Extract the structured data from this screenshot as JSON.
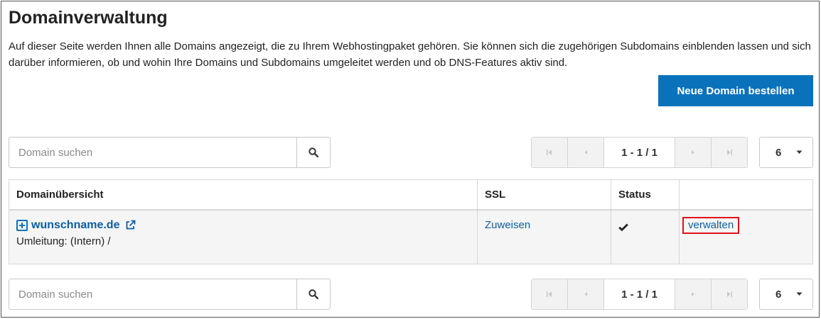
{
  "page": {
    "title": "Domainverwaltung",
    "description": "Auf dieser Seite werden Ihnen alle Domains angezeigt, die zu Ihrem Webhostingpaket gehören. Sie können sich die zugehörigen Subdomains einblenden lassen und sich darüber informieren, ob und wohin Ihre Domains und Subdomains umgeleitet werden und ob DNS-Features aktiv sind.",
    "order_button": "Neue Domain bestellen"
  },
  "search": {
    "placeholder": "Domain suchen",
    "value": "",
    "icon": "search-icon"
  },
  "pagination": {
    "info": "1 - 1 / 1",
    "per_page": "6"
  },
  "table": {
    "columns": [
      "Domainübersicht",
      "SSL",
      "Status",
      ""
    ],
    "rows": [
      {
        "domain": "wunschname.de",
        "redirect": "Umleitung: (Intern) /",
        "ssl": "Zuweisen",
        "status_icon": "checkmark-icon",
        "action": "verwalten"
      }
    ]
  },
  "colors": {
    "primary": "#0a72bb",
    "link": "#0a5fa3",
    "highlight": "#e0101a"
  }
}
